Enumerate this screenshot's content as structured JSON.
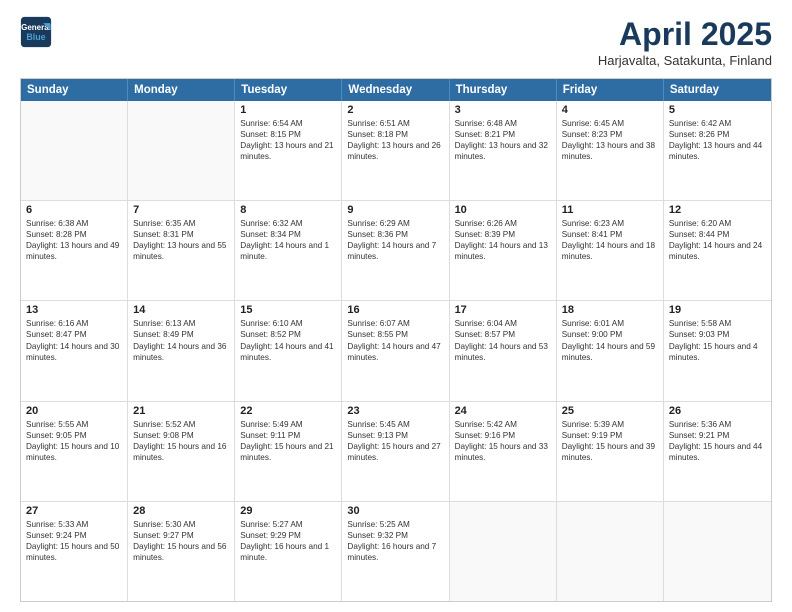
{
  "header": {
    "logo": {
      "line1": "General",
      "line2": "Blue"
    },
    "title": "April 2025",
    "subtitle": "Harjavalta, Satakunta, Finland"
  },
  "weekdays": [
    "Sunday",
    "Monday",
    "Tuesday",
    "Wednesday",
    "Thursday",
    "Friday",
    "Saturday"
  ],
  "rows": [
    [
      {
        "day": "",
        "sunrise": "",
        "sunset": "",
        "daylight": ""
      },
      {
        "day": "",
        "sunrise": "",
        "sunset": "",
        "daylight": ""
      },
      {
        "day": "1",
        "sunrise": "Sunrise: 6:54 AM",
        "sunset": "Sunset: 8:15 PM",
        "daylight": "Daylight: 13 hours and 21 minutes."
      },
      {
        "day": "2",
        "sunrise": "Sunrise: 6:51 AM",
        "sunset": "Sunset: 8:18 PM",
        "daylight": "Daylight: 13 hours and 26 minutes."
      },
      {
        "day": "3",
        "sunrise": "Sunrise: 6:48 AM",
        "sunset": "Sunset: 8:21 PM",
        "daylight": "Daylight: 13 hours and 32 minutes."
      },
      {
        "day": "4",
        "sunrise": "Sunrise: 6:45 AM",
        "sunset": "Sunset: 8:23 PM",
        "daylight": "Daylight: 13 hours and 38 minutes."
      },
      {
        "day": "5",
        "sunrise": "Sunrise: 6:42 AM",
        "sunset": "Sunset: 8:26 PM",
        "daylight": "Daylight: 13 hours and 44 minutes."
      }
    ],
    [
      {
        "day": "6",
        "sunrise": "Sunrise: 6:38 AM",
        "sunset": "Sunset: 8:28 PM",
        "daylight": "Daylight: 13 hours and 49 minutes."
      },
      {
        "day": "7",
        "sunrise": "Sunrise: 6:35 AM",
        "sunset": "Sunset: 8:31 PM",
        "daylight": "Daylight: 13 hours and 55 minutes."
      },
      {
        "day": "8",
        "sunrise": "Sunrise: 6:32 AM",
        "sunset": "Sunset: 8:34 PM",
        "daylight": "Daylight: 14 hours and 1 minute."
      },
      {
        "day": "9",
        "sunrise": "Sunrise: 6:29 AM",
        "sunset": "Sunset: 8:36 PM",
        "daylight": "Daylight: 14 hours and 7 minutes."
      },
      {
        "day": "10",
        "sunrise": "Sunrise: 6:26 AM",
        "sunset": "Sunset: 8:39 PM",
        "daylight": "Daylight: 14 hours and 13 minutes."
      },
      {
        "day": "11",
        "sunrise": "Sunrise: 6:23 AM",
        "sunset": "Sunset: 8:41 PM",
        "daylight": "Daylight: 14 hours and 18 minutes."
      },
      {
        "day": "12",
        "sunrise": "Sunrise: 6:20 AM",
        "sunset": "Sunset: 8:44 PM",
        "daylight": "Daylight: 14 hours and 24 minutes."
      }
    ],
    [
      {
        "day": "13",
        "sunrise": "Sunrise: 6:16 AM",
        "sunset": "Sunset: 8:47 PM",
        "daylight": "Daylight: 14 hours and 30 minutes."
      },
      {
        "day": "14",
        "sunrise": "Sunrise: 6:13 AM",
        "sunset": "Sunset: 8:49 PM",
        "daylight": "Daylight: 14 hours and 36 minutes."
      },
      {
        "day": "15",
        "sunrise": "Sunrise: 6:10 AM",
        "sunset": "Sunset: 8:52 PM",
        "daylight": "Daylight: 14 hours and 41 minutes."
      },
      {
        "day": "16",
        "sunrise": "Sunrise: 6:07 AM",
        "sunset": "Sunset: 8:55 PM",
        "daylight": "Daylight: 14 hours and 47 minutes."
      },
      {
        "day": "17",
        "sunrise": "Sunrise: 6:04 AM",
        "sunset": "Sunset: 8:57 PM",
        "daylight": "Daylight: 14 hours and 53 minutes."
      },
      {
        "day": "18",
        "sunrise": "Sunrise: 6:01 AM",
        "sunset": "Sunset: 9:00 PM",
        "daylight": "Daylight: 14 hours and 59 minutes."
      },
      {
        "day": "19",
        "sunrise": "Sunrise: 5:58 AM",
        "sunset": "Sunset: 9:03 PM",
        "daylight": "Daylight: 15 hours and 4 minutes."
      }
    ],
    [
      {
        "day": "20",
        "sunrise": "Sunrise: 5:55 AM",
        "sunset": "Sunset: 9:05 PM",
        "daylight": "Daylight: 15 hours and 10 minutes."
      },
      {
        "day": "21",
        "sunrise": "Sunrise: 5:52 AM",
        "sunset": "Sunset: 9:08 PM",
        "daylight": "Daylight: 15 hours and 16 minutes."
      },
      {
        "day": "22",
        "sunrise": "Sunrise: 5:49 AM",
        "sunset": "Sunset: 9:11 PM",
        "daylight": "Daylight: 15 hours and 21 minutes."
      },
      {
        "day": "23",
        "sunrise": "Sunrise: 5:45 AM",
        "sunset": "Sunset: 9:13 PM",
        "daylight": "Daylight: 15 hours and 27 minutes."
      },
      {
        "day": "24",
        "sunrise": "Sunrise: 5:42 AM",
        "sunset": "Sunset: 9:16 PM",
        "daylight": "Daylight: 15 hours and 33 minutes."
      },
      {
        "day": "25",
        "sunrise": "Sunrise: 5:39 AM",
        "sunset": "Sunset: 9:19 PM",
        "daylight": "Daylight: 15 hours and 39 minutes."
      },
      {
        "day": "26",
        "sunrise": "Sunrise: 5:36 AM",
        "sunset": "Sunset: 9:21 PM",
        "daylight": "Daylight: 15 hours and 44 minutes."
      }
    ],
    [
      {
        "day": "27",
        "sunrise": "Sunrise: 5:33 AM",
        "sunset": "Sunset: 9:24 PM",
        "daylight": "Daylight: 15 hours and 50 minutes."
      },
      {
        "day": "28",
        "sunrise": "Sunrise: 5:30 AM",
        "sunset": "Sunset: 9:27 PM",
        "daylight": "Daylight: 15 hours and 56 minutes."
      },
      {
        "day": "29",
        "sunrise": "Sunrise: 5:27 AM",
        "sunset": "Sunset: 9:29 PM",
        "daylight": "Daylight: 16 hours and 1 minute."
      },
      {
        "day": "30",
        "sunrise": "Sunrise: 5:25 AM",
        "sunset": "Sunset: 9:32 PM",
        "daylight": "Daylight: 16 hours and 7 minutes."
      },
      {
        "day": "",
        "sunrise": "",
        "sunset": "",
        "daylight": ""
      },
      {
        "day": "",
        "sunrise": "",
        "sunset": "",
        "daylight": ""
      },
      {
        "day": "",
        "sunrise": "",
        "sunset": "",
        "daylight": ""
      }
    ]
  ]
}
